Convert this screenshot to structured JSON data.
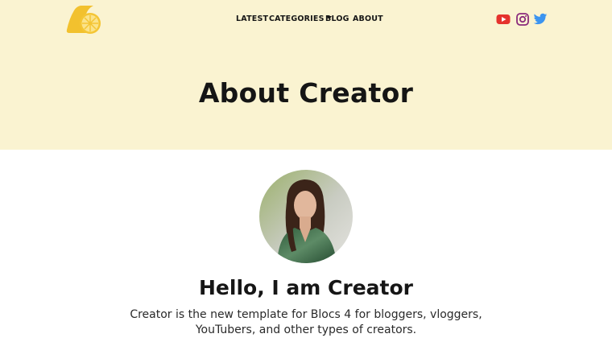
{
  "nav": {
    "items": [
      {
        "label": "LATEST"
      },
      {
        "label": "CATEGORIES"
      },
      {
        "label": "BLOG"
      },
      {
        "label": "ABOUT"
      }
    ]
  },
  "social": {
    "icons": [
      "youtube-icon",
      "instagram-icon",
      "twitter-icon"
    ],
    "colors": {
      "youtube": "#e5322d",
      "instagram": "#8a2b7c",
      "twitter": "#3b94f0"
    }
  },
  "hero": {
    "title": "About Creator",
    "background": "#faf3d1"
  },
  "profile": {
    "heading": "Hello, I am Creator",
    "intro": "Creator is the new template for Blocs 4 for bloggers, vloggers, YouTubers, and other types of creators."
  }
}
